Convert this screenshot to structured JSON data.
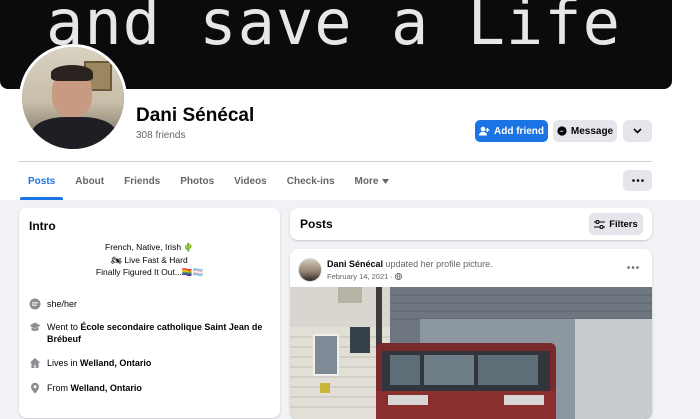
{
  "cover": {
    "text": "and save a Life"
  },
  "profile": {
    "name": "Dani Sénécal",
    "friends": "308 friends"
  },
  "actions": {
    "add_friend": "Add friend",
    "message": "Message"
  },
  "tabs": [
    {
      "label": "Posts"
    },
    {
      "label": "About"
    },
    {
      "label": "Friends"
    },
    {
      "label": "Photos"
    },
    {
      "label": "Videos"
    },
    {
      "label": "Check-ins"
    },
    {
      "label": "More"
    }
  ],
  "intro": {
    "title": "Intro",
    "bio": [
      "French, Native, Irish 🌵",
      "🏍 Live Fast & Hard",
      "Finally Figured It Out...🏳‍🌈🏳‍⚧"
    ],
    "pronouns": "she/her",
    "education_prefix": "Went to ",
    "education_school": "École secondaire catholique Saint Jean de Brébeuf",
    "lives_prefix": "Lives in ",
    "lives_place": "Welland, Ontario",
    "from_prefix": "From ",
    "from_place": "Welland, Ontario"
  },
  "posts": {
    "title": "Posts",
    "filters_label": "Filters",
    "items": [
      {
        "author": "Dani Sénécal",
        "action": "updated her profile picture.",
        "date": "February 14, 2021 · "
      }
    ]
  },
  "colors": {
    "accent": "#1b74e4",
    "background": "#f0f2f5",
    "secondary_text": "#65676b"
  }
}
